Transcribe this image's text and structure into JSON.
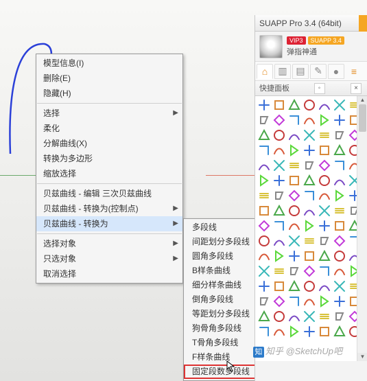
{
  "panel": {
    "title": "SUAPP Pro 3.4 (64bit)",
    "user": {
      "vip_badge": "VIP3",
      "app_badge": "SUAPP 3.4",
      "name": "弹指神通"
    },
    "section_header": "快捷面板",
    "section_btn1": "◦",
    "section_btn2": "×"
  },
  "context_menu": {
    "items": [
      {
        "label": "模型信息(I)"
      },
      {
        "label": "删除(E)"
      },
      {
        "label": "隐藏(H)"
      },
      {
        "sep": true
      },
      {
        "label": "选择",
        "sub": true
      },
      {
        "label": "柔化"
      },
      {
        "label": "分解曲线(X)"
      },
      {
        "label": "转换为多边形"
      },
      {
        "label": "缩放选择"
      },
      {
        "sep": true
      },
      {
        "label": "贝兹曲线 - 编辑 三次贝兹曲线"
      },
      {
        "label": "贝兹曲线 - 转换为(控制点)",
        "sub": true
      },
      {
        "label": "贝兹曲线 - 转换为",
        "sub": true,
        "hl": true
      },
      {
        "sep": true
      },
      {
        "label": "选择对象",
        "sub": true
      },
      {
        "label": "只选对象",
        "sub": true
      },
      {
        "label": "取消选择"
      }
    ]
  },
  "submenu": {
    "items": [
      "多段线",
      "间距划分多段线",
      "圆角多段线",
      "B样条曲线",
      "细分样条曲线",
      "倒角多段线",
      "等距划分多段线",
      "狗骨角多段线",
      "T骨角多段线",
      "F样条曲线",
      "固定段数多段线"
    ],
    "selected_index": 10
  },
  "watermark": "知乎 @SketchUp吧"
}
